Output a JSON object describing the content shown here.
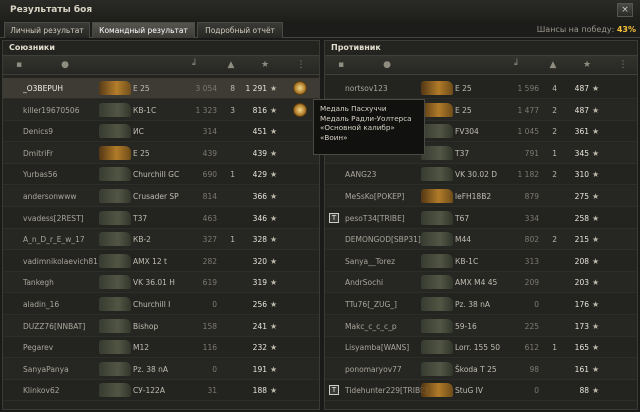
{
  "window": {
    "title": "Результаты боя",
    "close_glyph": "×"
  },
  "tabs": [
    {
      "label": "Личный результат",
      "active": false
    },
    {
      "label": "Командный результат",
      "active": true
    },
    {
      "label": "Подробный отчёт",
      "active": false
    }
  ],
  "win_chance": {
    "label": "Шансы на победу:",
    "value": "43%"
  },
  "allies": {
    "title": "Союзники",
    "rows": [
      {
        "name": "_O3BEPUH",
        "vehicle": "E 25",
        "damage": "3 054",
        "kills": "8",
        "xp": "1 291",
        "tank_color": "gold",
        "me": true
      },
      {
        "name": "killer19670506",
        "vehicle": "КВ-1С",
        "damage": "1 323",
        "kills": "3",
        "xp": "816",
        "tank_color": ""
      },
      {
        "name": "Denics9",
        "vehicle": "ИС",
        "damage": "314",
        "kills": "",
        "xp": "451",
        "tank_color": ""
      },
      {
        "name": "DmitriFr",
        "vehicle": "E 25",
        "damage": "439",
        "kills": "",
        "xp": "439",
        "tank_color": "gold"
      },
      {
        "name": "Yurbas56",
        "vehicle": "Churchill GC",
        "damage": "690",
        "kills": "1",
        "xp": "429",
        "tank_color": ""
      },
      {
        "name": "andersonwww",
        "vehicle": "Crusader SP",
        "damage": "814",
        "kills": "",
        "xp": "366",
        "tank_color": ""
      },
      {
        "name": "vvadess[2REST]",
        "vehicle": "T37",
        "damage": "463",
        "kills": "",
        "xp": "346",
        "tank_color": ""
      },
      {
        "name": "A_n_D_r_E_w_17",
        "vehicle": "КВ-2",
        "damage": "327",
        "kills": "1",
        "xp": "328",
        "tank_color": ""
      },
      {
        "name": "vadimnikolaevich81",
        "vehicle": "AMX 12 t",
        "damage": "282",
        "kills": "",
        "xp": "320",
        "tank_color": ""
      },
      {
        "name": "Tankegh",
        "vehicle": "VK 36.01 H",
        "damage": "619",
        "kills": "",
        "xp": "319",
        "tank_color": ""
      },
      {
        "name": "aladin_16",
        "vehicle": "Churchill I",
        "damage": "0",
        "kills": "",
        "xp": "256",
        "tank_color": ""
      },
      {
        "name": "DUZZ76[NNBAT]",
        "vehicle": "Bishop",
        "damage": "158",
        "kills": "",
        "xp": "241",
        "tank_color": ""
      },
      {
        "name": "Pegarev",
        "vehicle": "M12",
        "damage": "116",
        "kills": "",
        "xp": "232",
        "tank_color": ""
      },
      {
        "name": "SanyaPanya",
        "vehicle": "Pz. 38 nA",
        "damage": "0",
        "kills": "",
        "xp": "191",
        "tank_color": ""
      },
      {
        "name": "Klinkov62",
        "vehicle": "СУ-122А",
        "damage": "31",
        "kills": "",
        "xp": "188",
        "tank_color": ""
      }
    ]
  },
  "enemies": {
    "title": "Противник",
    "rows": [
      {
        "name": "nortsov123",
        "vehicle": "E 25",
        "damage": "1 596",
        "kills": "4",
        "xp": "487",
        "tank_color": "gold"
      },
      {
        "name": "",
        "vehicle": "E 25",
        "damage": "1 477",
        "kills": "2",
        "xp": "487",
        "tank_color": "gold"
      },
      {
        "name": "",
        "vehicle": "FV304",
        "damage": "1 045",
        "kills": "2",
        "xp": "361",
        "tank_color": ""
      },
      {
        "name": "",
        "vehicle": "T37",
        "damage": "791",
        "kills": "1",
        "xp": "345",
        "tank_color": ""
      },
      {
        "name": "AANG23",
        "vehicle": "VK 30.02 D",
        "damage": "1 182",
        "kills": "2",
        "xp": "310",
        "tank_color": ""
      },
      {
        "name": "MeSsKo[POKEP]",
        "vehicle": "leFH18B2",
        "damage": "879",
        "kills": "",
        "xp": "275",
        "tank_color": "gold"
      },
      {
        "name": "pesoT34[TRIBE]",
        "vehicle": "T67",
        "damage": "334",
        "kills": "",
        "xp": "258",
        "tank_color": "",
        "platoon": "T"
      },
      {
        "name": "DEMONGOD[SBP31]",
        "vehicle": "M44",
        "damage": "802",
        "kills": "2",
        "xp": "215",
        "tank_color": ""
      },
      {
        "name": "Sanya__Torez",
        "vehicle": "КВ-1С",
        "damage": "313",
        "kills": "",
        "xp": "208",
        "tank_color": ""
      },
      {
        "name": "AndrSochi",
        "vehicle": "AMX M4 45",
        "damage": "209",
        "kills": "",
        "xp": "203",
        "tank_color": ""
      },
      {
        "name": "TTu76[_ZUG_]",
        "vehicle": "Pz. 38 nA",
        "damage": "0",
        "kills": "",
        "xp": "176",
        "tank_color": ""
      },
      {
        "name": "Makc_c_c_c_p",
        "vehicle": "59-16",
        "damage": "225",
        "kills": "",
        "xp": "173",
        "tank_color": ""
      },
      {
        "name": "Lisyamba[WANS]",
        "vehicle": "Lorr. 155 50",
        "damage": "612",
        "kills": "1",
        "xp": "165",
        "tank_color": ""
      },
      {
        "name": "ponomaryov77",
        "vehicle": "Škoda T 25",
        "damage": "98",
        "kills": "",
        "xp": "161",
        "tank_color": ""
      },
      {
        "name": "Tidehunter229[TRIBE]",
        "vehicle": "StuG IV",
        "damage": "0",
        "kills": "",
        "xp": "88",
        "tank_color": "gold",
        "platoon": "T"
      }
    ]
  },
  "tooltip": {
    "lines": [
      "Медаль Пасхуччи",
      "Медаль Радли-Уолтерса",
      "«Основной калибр»",
      "«Воин»"
    ]
  },
  "star_glyph": "★"
}
